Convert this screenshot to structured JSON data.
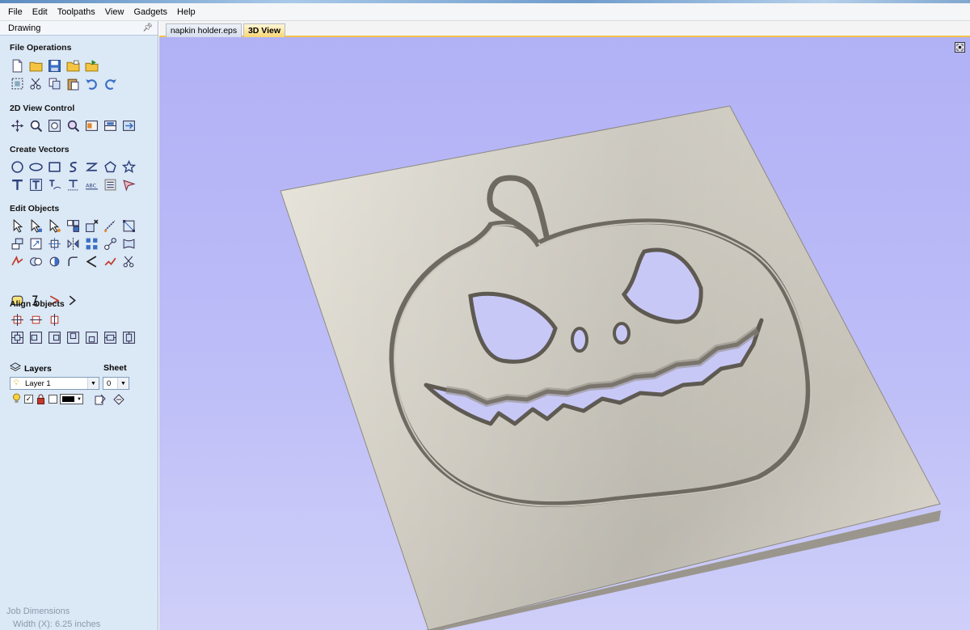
{
  "menu": [
    "File",
    "Edit",
    "Toolpaths",
    "View",
    "Gadgets",
    "Help"
  ],
  "panel": {
    "title": "Drawing",
    "sections": {
      "file_operations": "File Operations",
      "view_control": "2D View Control",
      "create_vectors": "Create Vectors",
      "edit_objects": "Edit Objects",
      "align_objects": "Align Objects"
    },
    "layers": {
      "label": "Layers",
      "sheet_label": "Sheet",
      "layer_value": "Layer 1",
      "sheet_value": "0"
    }
  },
  "tabs": {
    "file_tab": "napkin holder.eps",
    "view_tab": "3D View"
  },
  "job": {
    "title": "Job Dimensions",
    "width_line": "Width  (X): 6.25 inches"
  },
  "colors": {
    "panel_bg": "#dbe8f5",
    "viewport_bg": "#b8b8f7",
    "active_tab": "#f8d675",
    "board": "#dcd8ce"
  }
}
